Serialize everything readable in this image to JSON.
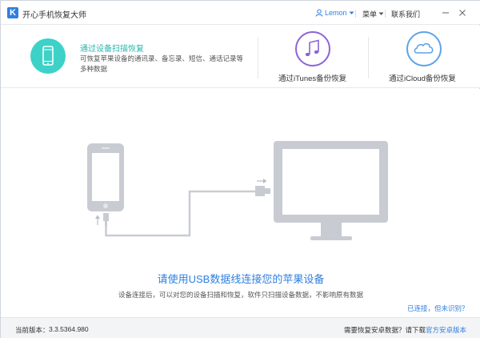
{
  "app": {
    "title": "开心手机恢复大师",
    "logo_letter": "K"
  },
  "titlebar": {
    "user_label": "Lemon",
    "menu_label": "菜单",
    "contact_label": "联系我们"
  },
  "tabs": [
    {
      "title": "通过设备扫描恢复",
      "description": "可恢复苹果设备的通讯录、备忘录、短信、通话记录等多种数据"
    },
    {
      "label": "通过iTunes备份恢复"
    },
    {
      "label": "通过iCloud备份恢复"
    }
  ],
  "main": {
    "headline": "请使用USB数据线连接您的苹果设备",
    "subline": "设备连接后，可以对您的设备扫描和恢复，软件只扫描设备数据，不影响原有数据",
    "connected_link": "已连接，但未识别？"
  },
  "footer": {
    "version_label": "当前版本：",
    "version_value": "3.3.5364.980",
    "android_prompt": "需要恢复安卓数据？请下载",
    "android_link": "官方安卓版本"
  },
  "colors": {
    "accent": "#2f7fe0",
    "teal": "#3dd2c7",
    "purple": "#8c63d6",
    "sky": "#5da4e8",
    "device_gray": "#c8ccd2"
  }
}
